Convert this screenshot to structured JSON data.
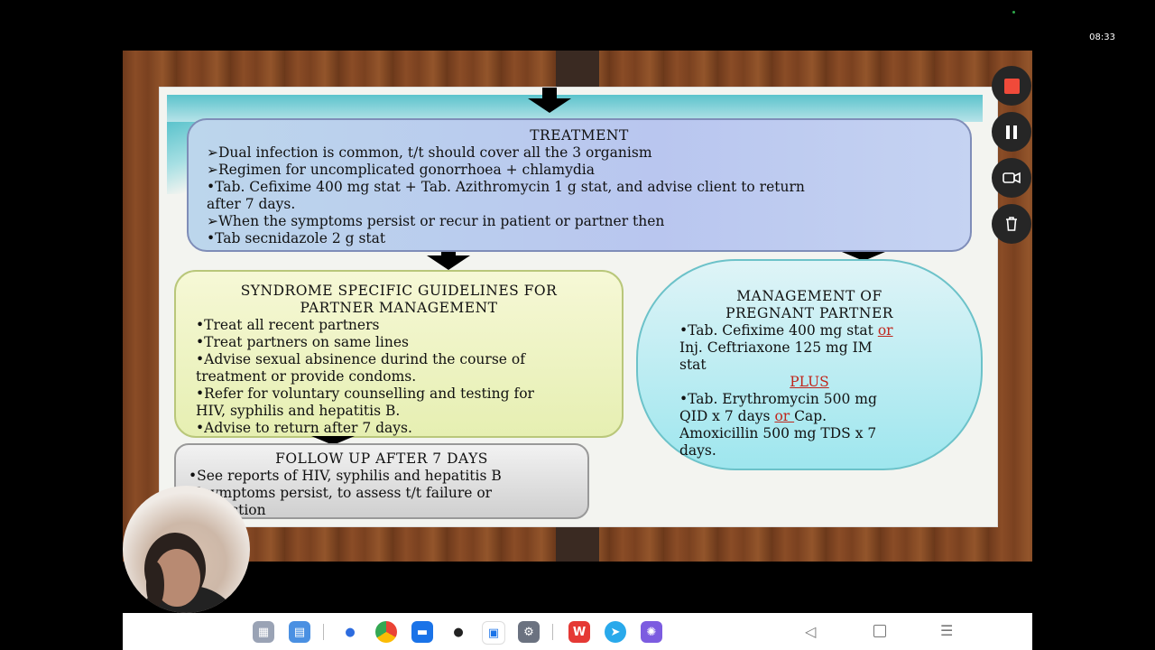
{
  "status": {
    "time": "08:33"
  },
  "slide": {
    "treatment": {
      "title": "TREATMENT",
      "lines": [
        "➢Dual infection is common, t/t should cover all the 3 organism",
        "➢Regimen for uncomplicated gonorrhoea + chlamydia",
        "•Tab. Cefixime 400 mg stat + Tab. Azithromycin 1 g stat, and advise client to return",
        "after 7 days.",
        "➢When the symptoms persist or recur in patient or partner then",
        "•Tab secnidazole 2 g stat"
      ]
    },
    "syndrome": {
      "title1": "SYNDROME SPECIFIC GUIDELINES FOR",
      "title2": "PARTNER MANAGEMENT",
      "lines": [
        "•Treat all recent partners",
        "•Treat partners on same lines",
        "•Advise sexual absinence durind the course of",
        "treatment or provide condoms.",
        "•Refer for voluntary counselling and testing for",
        "HIV, syphilis and hepatitis B.",
        "•Advise to return after 7 days."
      ]
    },
    "pregnant": {
      "title1": "MANAGEMENT OF",
      "title2": "PREGNANT PARTNER",
      "l1a": "•Tab. Cefixime 400 mg stat ",
      "or1": "or",
      "l2": "Inj. Ceftriaxone 125 mg IM",
      "l3": "stat",
      "plus": "PLUS",
      "l4": "•Tab. Erythromycin 500 mg",
      "l5a": "QID x 7 days ",
      "or2": "or ",
      "l5b": " Cap.",
      "l6": "Amoxicillin 500 mg TDS x 7",
      "l7": "days."
    },
    "followup": {
      "title": "FOLLOW UP AFTER 7 DAYS",
      "lines": [
        "•See reports of HIV, syphilis and hepatitis B",
        "If symptoms persist, to assess t/t failure or",
        "reinfection"
      ]
    }
  },
  "controls": [
    {
      "name": "stop",
      "icon": "stop-icon",
      "color": "#f04a3a"
    },
    {
      "name": "pause",
      "icon": "pause-icon",
      "color": "#ffffff"
    },
    {
      "name": "camera",
      "icon": "camera-switch-icon",
      "color": "#ffffff"
    },
    {
      "name": "delete",
      "icon": "trash-icon",
      "color": "#ffffff"
    }
  ],
  "taskbar": {
    "apps": [
      "apps-grid-icon",
      "files-icon",
      "messages-icon",
      "chrome-icon",
      "gallery-icon",
      "camera-icon",
      "calendar-icon",
      "settings-icon",
      "wps-office-icon",
      "telegram-icon",
      "app-star-icon"
    ],
    "nav": [
      "back-icon",
      "home-icon",
      "menu-icon"
    ]
  }
}
